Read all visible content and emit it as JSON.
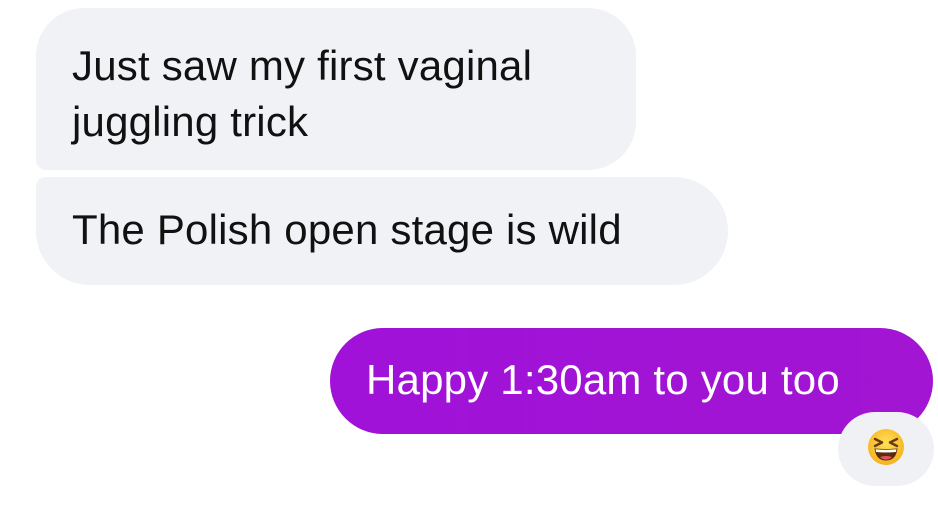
{
  "messages": [
    {
      "sender": "other",
      "text": "Just saw my first vaginal juggling trick"
    },
    {
      "sender": "other",
      "text": "The Polish open stage is wild"
    },
    {
      "sender": "me",
      "text": "Happy 1:30am to you too",
      "bubble_color": "#a313d6"
    }
  ],
  "reaction": {
    "icon": "laughing-emoji-icon"
  },
  "colors": {
    "incoming_bubble": "#f1f2f6",
    "outgoing_bubble": "#a313d6",
    "incoming_text": "#111111",
    "outgoing_text": "#ffffff"
  }
}
